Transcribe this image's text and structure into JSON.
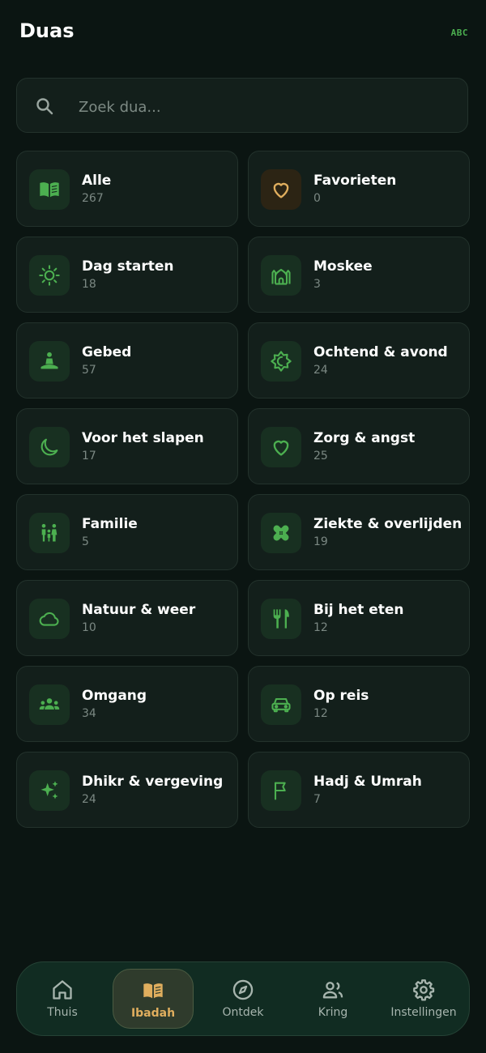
{
  "header": {
    "title": "Duas",
    "abc_label": "ABC"
  },
  "search": {
    "placeholder": "Zoek dua..."
  },
  "categories": [
    {
      "label": "Alle",
      "count": "267",
      "icon": "book-open-icon"
    },
    {
      "label": "Favorieten",
      "count": "0",
      "icon": "heart-outline-icon"
    },
    {
      "label": "Dag starten",
      "count": "18",
      "icon": "sun-icon"
    },
    {
      "label": "Moskee",
      "count": "3",
      "icon": "mosque-icon"
    },
    {
      "label": "Gebed",
      "count": "57",
      "icon": "prayer-person-icon"
    },
    {
      "label": "Ochtend & avond",
      "count": "24",
      "icon": "sun-moon-icon"
    },
    {
      "label": "Voor het slapen",
      "count": "17",
      "icon": "moon-icon"
    },
    {
      "label": "Zorg & angst",
      "count": "25",
      "icon": "heart-icon"
    },
    {
      "label": "Familie",
      "count": "5",
      "icon": "family-icon"
    },
    {
      "label": "Ziekte & overlijden",
      "count": "19",
      "icon": "bandage-icon"
    },
    {
      "label": "Natuur & weer",
      "count": "10",
      "icon": "cloud-icon"
    },
    {
      "label": "Bij het eten",
      "count": "12",
      "icon": "fork-knife-icon"
    },
    {
      "label": "Omgang",
      "count": "34",
      "icon": "group-icon"
    },
    {
      "label": "Op reis",
      "count": "12",
      "icon": "car-icon"
    },
    {
      "label": "Dhikr & vergeving",
      "count": "24",
      "icon": "sparkles-icon"
    },
    {
      "label": "Hadj & Umrah",
      "count": "7",
      "icon": "flag-icon"
    }
  ],
  "nav": [
    {
      "label": "Thuis",
      "icon": "home-icon"
    },
    {
      "label": "Ibadah",
      "icon": "book-icon",
      "active": true
    },
    {
      "label": "Ontdek",
      "icon": "compass-icon"
    },
    {
      "label": "Kring",
      "icon": "people-icon"
    },
    {
      "label": "Instellingen",
      "icon": "gear-icon"
    }
  ],
  "colors": {
    "background": "#0b1512",
    "card": "#131f1b",
    "accent_green": "#4caf50",
    "accent_gold": "#e0ae5e"
  }
}
